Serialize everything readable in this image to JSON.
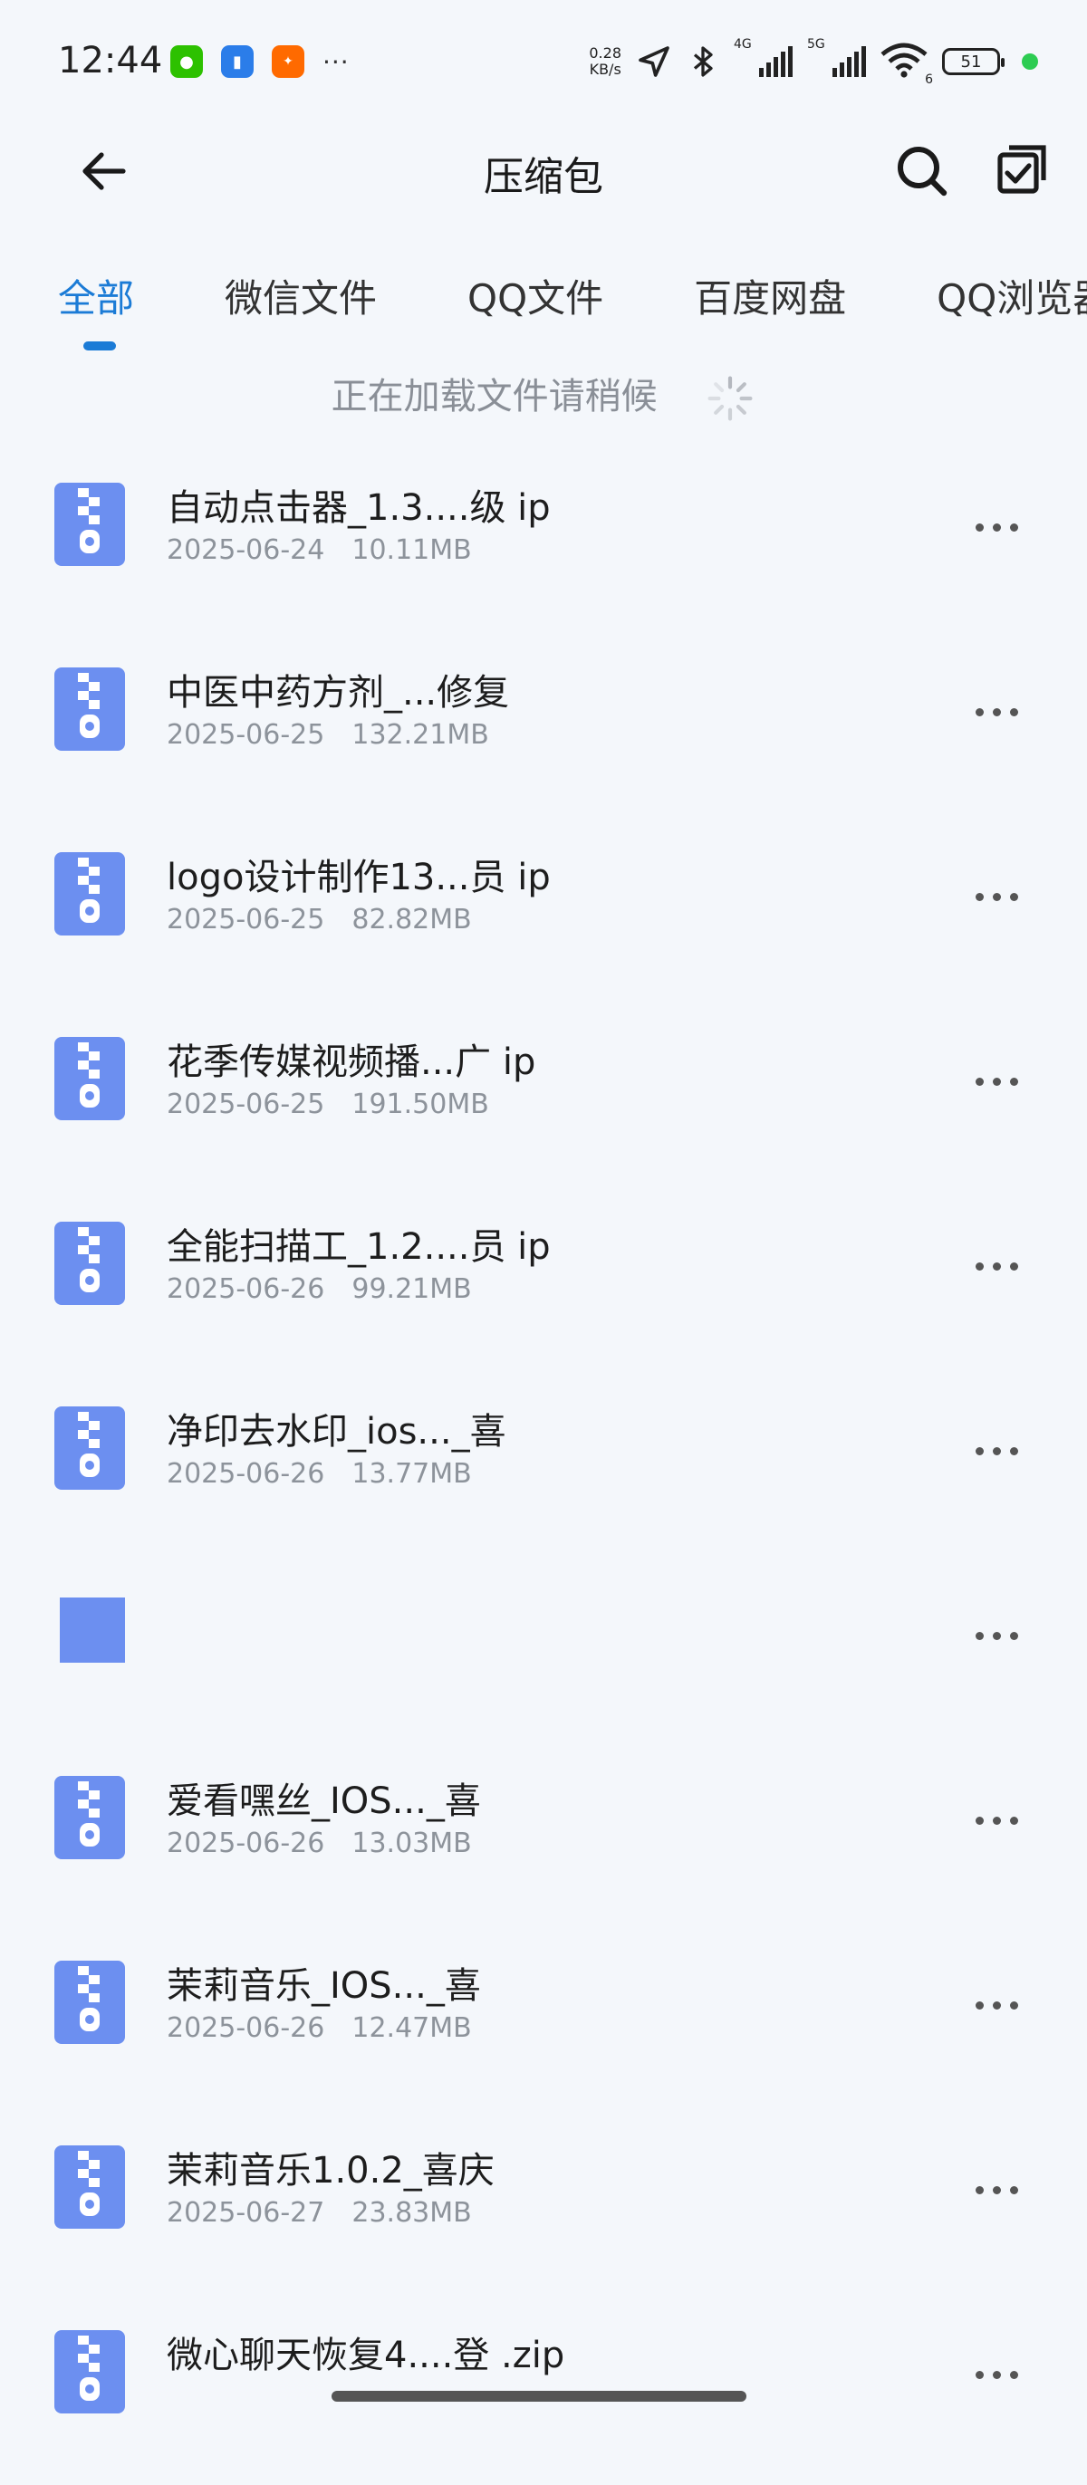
{
  "status": {
    "time": "12:44",
    "net_speed": "0.28",
    "net_unit": "KB/s",
    "sig1_tag": "4G",
    "sig2_tag": "5G",
    "wifi_sub": "6",
    "battery": "51",
    "notif_more": "···"
  },
  "header": {
    "title": "压缩包"
  },
  "tabs": [
    {
      "label": "全部",
      "active": true
    },
    {
      "label": "微信文件"
    },
    {
      "label": "QQ文件"
    },
    {
      "label": "百度网盘"
    },
    {
      "label": "QQ浏览器"
    }
  ],
  "loading_text": "正在加载文件请稍候",
  "files": [
    {
      "name": "自动点击器_1.3....级                   ip",
      "date": "2025-06-24",
      "size": "10.11MB"
    },
    {
      "name": "中医中药方剂_...修复",
      "date": "2025-06-25",
      "size": "132.21MB"
    },
    {
      "name": "logo设计制作13...员                   ip",
      "date": "2025-06-25",
      "size": "82.82MB"
    },
    {
      "name": "花季传媒视频播...广                   ip",
      "date": "2025-06-25",
      "size": "191.50MB"
    },
    {
      "name": "全能扫描工_1.2....员                   ip",
      "date": "2025-06-26",
      "size": "99.21MB"
    },
    {
      "name": "净印去水印_ios..._喜",
      "date": "2025-06-26",
      "size": "13.77MB"
    },
    {
      "name": "",
      "date": "",
      "size": "",
      "placeholder": true
    },
    {
      "name": "爱看嘿丝_IOS..._喜",
      "date": "2025-06-26",
      "size": "13.03MB"
    },
    {
      "name": "茉莉音乐_IOS..._喜",
      "date": "2025-06-26",
      "size": "12.47MB"
    },
    {
      "name": "茉莉音乐1.0.2_喜庆",
      "date": "2025-06-27",
      "size": "23.83MB"
    },
    {
      "name": "微心聊天恢复4....登              .zip",
      "date": "",
      "size": ""
    }
  ]
}
